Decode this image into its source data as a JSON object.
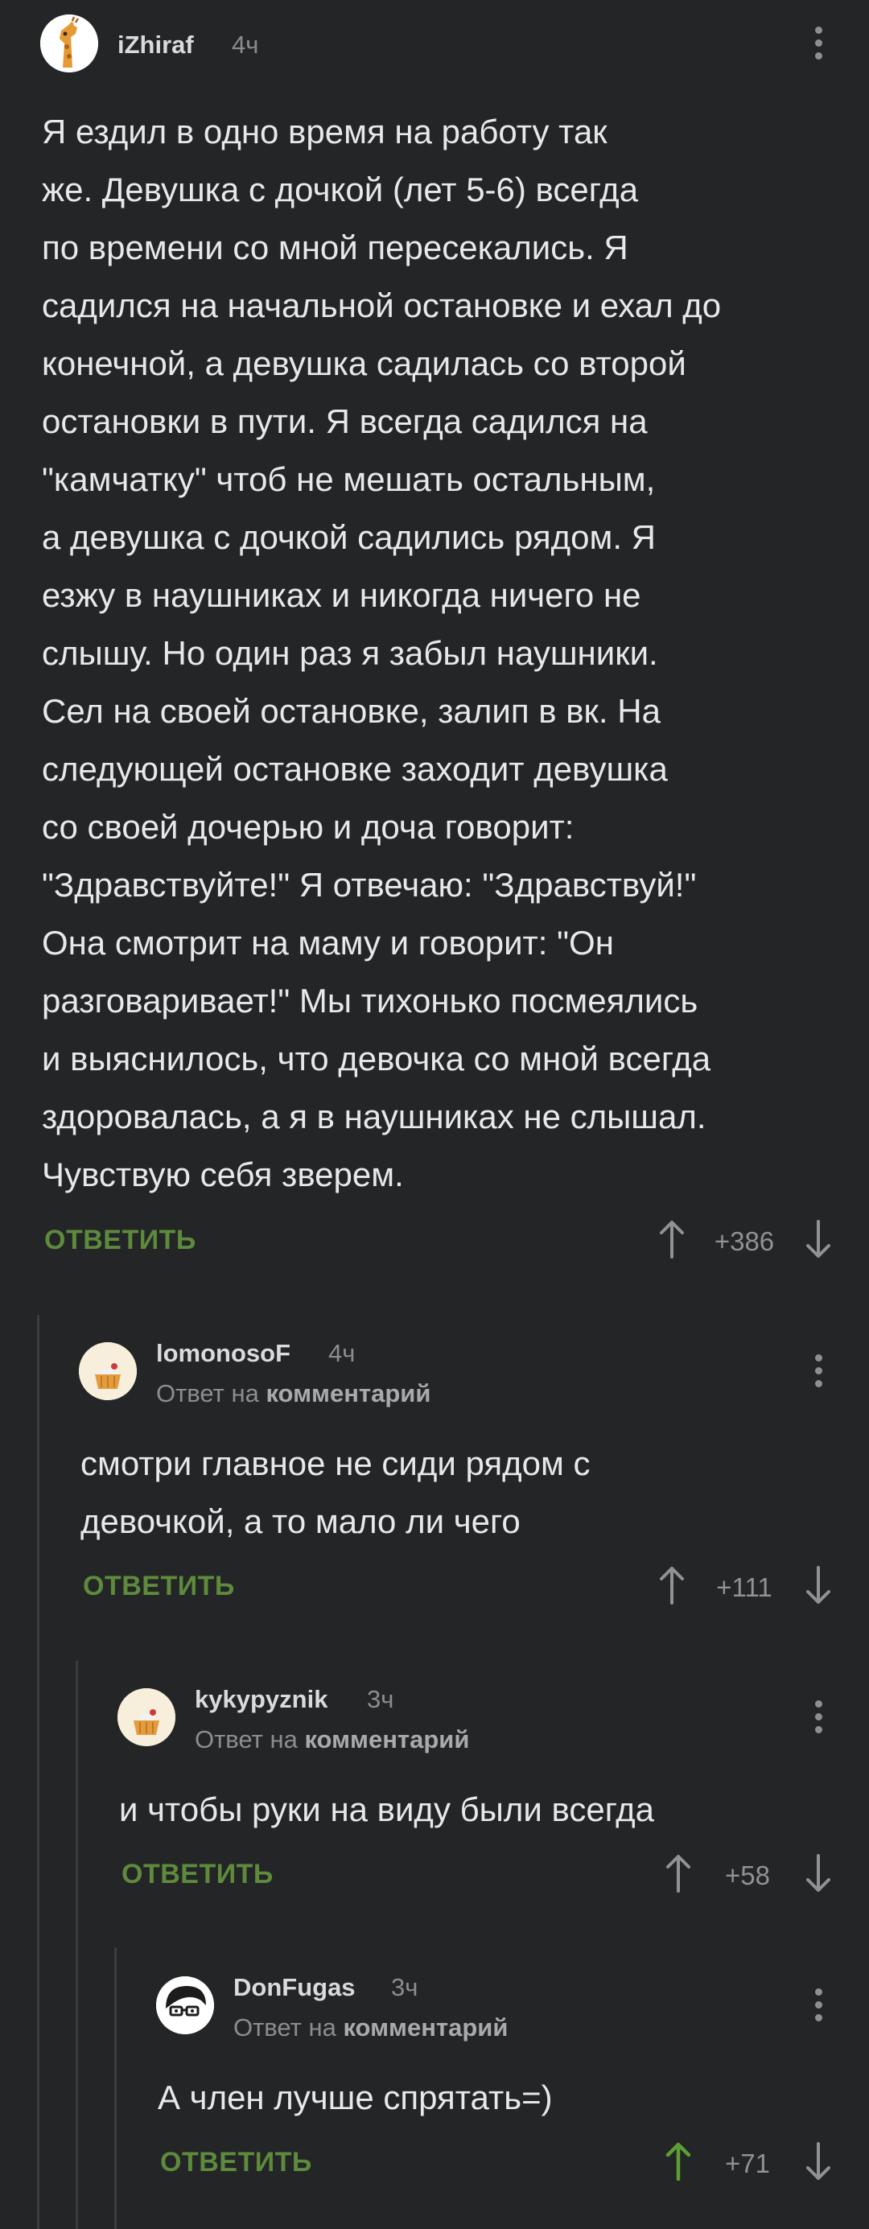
{
  "comments": [
    {
      "author": "iZhiraf",
      "time": "4ч",
      "avatar": "giraffe-avatar",
      "text": "Я ездил в одно время на работу так\nже. Девушка с дочкой (лет 5-6) всегда\nпо времени со мной пересекались. Я\nсадился на начальной остановке и ехал до\nконечной, а девушка садилась со второй\nостановки в пути. Я всегда садился на\n\"камчатку\" чтоб не мешать остальным,\nа девушка с дочкой садились рядом. Я\nезжу в наушниках и никогда ничего не\nслышу. Но один раз я забыл наушники.\nСел на своей остановке, залип в вк. На\nследующей остановке заходит девушка\nсо своей дочерью и доча говорит:\n\"Здравствуйте!\" Я отвечаю: \"Здравствуй!\"\nОна смотрит на маму и говорит: \"Он\nразговаривает!\" Мы тихонько посмеялись\nи выяснилось, что девочка со мной всегда\nздоровалась, а я в наушниках не слышал.\nЧувствую себя зверем.",
      "reply_label": "ОТВЕТИТЬ",
      "rating": "+386",
      "upvoted": false
    },
    {
      "author": "lomonosoF",
      "time": "4ч",
      "avatar": "cupcake-avatar",
      "reply_prefix": "Ответ на",
      "reply_link": "комментарий",
      "text": "смотри главное не сиди рядом с\nдевочкой, а то мало ли чего",
      "reply_label": "ОТВЕТИТЬ",
      "rating": "+111",
      "upvoted": false
    },
    {
      "author": "kykypyznik",
      "time": "3ч",
      "avatar": "cupcake-avatar",
      "reply_prefix": "Ответ на",
      "reply_link": "комментарий",
      "text": "и чтобы руки на виду были всегда",
      "reply_label": "ОТВЕТИТЬ",
      "rating": "+58",
      "upvoted": false
    },
    {
      "author": "DonFugas",
      "time": "3ч",
      "avatar": "glasses-face-avatar",
      "reply_prefix": "Ответ на",
      "reply_link": "комментарий",
      "text": "А член лучше спрятать=)",
      "reply_label": "ОТВЕТИТЬ",
      "rating": "+71",
      "upvoted": true
    }
  ],
  "colors": {
    "background": "#232526",
    "reply_green": "#5d8a3c",
    "upvoted_green": "#5d9e34",
    "muted_text": "#8a8e90",
    "thread_line": "#3a3d3f"
  }
}
